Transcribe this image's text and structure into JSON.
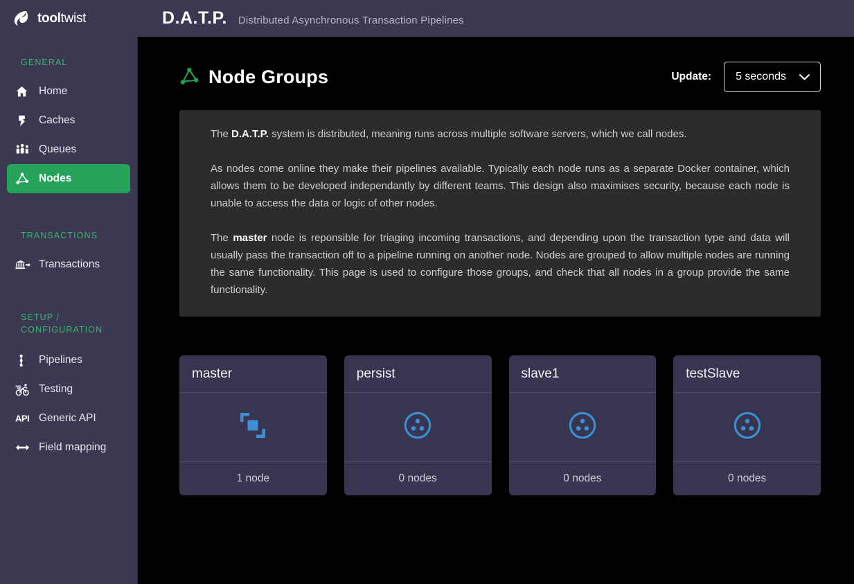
{
  "topbar": {
    "logo_icon": "tooltwist-flame-logo",
    "logo_bold": "tool",
    "logo_regular": "twist",
    "brand_title": "D.A.T.P.",
    "brand_subtitle": "Distributed Asynchronous Transaction Pipelines"
  },
  "sidebar": {
    "groups": [
      {
        "title": "GENERAL",
        "items": [
          {
            "label": "Home",
            "icon": "home-icon",
            "active": false
          },
          {
            "label": "Caches",
            "icon": "lightning-bolt-icon",
            "active": false
          },
          {
            "label": "Queues",
            "icon": "people-queue-icon",
            "active": false
          },
          {
            "label": "Nodes",
            "icon": "node-graph-icon",
            "active": true
          }
        ]
      },
      {
        "title": "TRANSACTIONS",
        "items": [
          {
            "label": "Transactions",
            "icon": "bank-transfer-icon",
            "active": false
          }
        ]
      },
      {
        "title": "SETUP / CONFIGURATION",
        "items": [
          {
            "label": "Pipelines",
            "icon": "pipeline-nodes-icon",
            "active": false
          },
          {
            "label": "Testing",
            "icon": "cyclist-icon",
            "active": false
          },
          {
            "label": "Generic API",
            "icon": "api-text-icon",
            "active": false
          },
          {
            "label": "Field mapping",
            "icon": "left-right-arrow-icon",
            "active": false
          }
        ]
      }
    ]
  },
  "page": {
    "title": "Node Groups",
    "title_icon": "node-graph-icon",
    "update_label": "Update:",
    "update_value": "5 seconds",
    "update_options": [
      "5 seconds"
    ],
    "chevron_icon": "chevron-down-icon"
  },
  "info": {
    "p1_pre": "The ",
    "p1_bold": "D.A.T.P.",
    "p1_post": " system is distributed, meaning runs across multiple software servers, which we call nodes.",
    "p2": "As nodes come online they make their pipelines available. Typically each node runs as a separate Docker container, which allows them to be developed independantly by different teams. This design also maximises security, because each node is unable to access the data or logic of other nodes.",
    "p3_pre": "The ",
    "p3_bold": "master",
    "p3_post": " node is reponsible for triaging incoming transactions, and depending upon the transaction type and data will usually pass the transaction off to a pipeline running on another node. Nodes are grouped to allow multiple nodes are running the same functionality. This page is used to configure those groups, and check that all nodes in a group provide the same functionality."
  },
  "node_groups": [
    {
      "name": "master",
      "icon": "clone-squares-icon",
      "count_label": "1 node"
    },
    {
      "name": "persist",
      "icon": "circle-three-dots-icon",
      "count_label": "0 nodes"
    },
    {
      "name": "slave1",
      "icon": "circle-three-dots-icon",
      "count_label": "0 nodes"
    },
    {
      "name": "testSlave",
      "icon": "circle-three-dots-icon",
      "count_label": "0 nodes"
    }
  ],
  "colors": {
    "topbar_bg": "#3b3851",
    "sidebar_bg": "#3b3851",
    "main_bg": "#000000",
    "accent_green": "#25a35a",
    "section_title_green": "#3cb371",
    "info_panel_bg": "#2c2c2c",
    "card_bg": "#373550",
    "card_icon_blue": "#3d8fd6"
  }
}
